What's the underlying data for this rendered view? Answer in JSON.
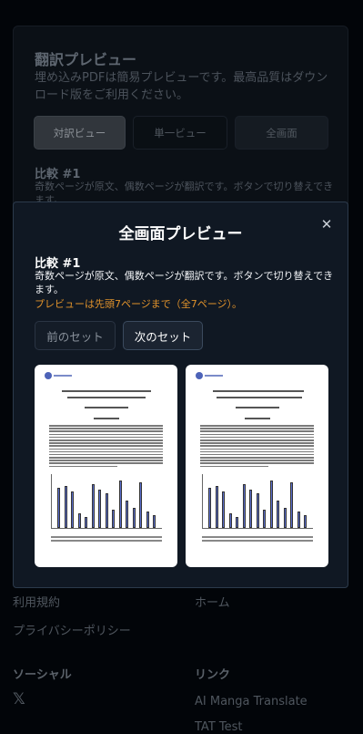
{
  "background": {
    "title": "翻訳プレビュー",
    "description": "埋め込みPDFは簡易プレビューです。最高品質はダウンロード版をご利用ください。",
    "view_buttons": {
      "side_by_side": "対訳ビュー",
      "single": "単一ビュー",
      "fullscreen": "全画面"
    },
    "compare_title": "比較 #1",
    "compare_desc": "奇数ページが原文、偶数ページが翻訳です。ボタンで切り替えできます。",
    "footer": {
      "terms": "利用規約",
      "privacy": "プライバシーポリシー",
      "home": "ホーム",
      "social_heading": "ソーシャル",
      "links_heading": "リンク",
      "x_icon_label": "𝕏",
      "link_manga": "AI Manga Translate",
      "link_tat": "TAT Test"
    }
  },
  "modal": {
    "title": "全画面プレビュー",
    "close_icon": "close-icon",
    "compare_title": "比較 #1",
    "compare_desc": "奇数ページが原文、偶数ページが翻訳です。ボタンで切り替えできます。",
    "note": "プレビューは先頭7ページまで（全7ページ）。",
    "prev_button": "前のセット",
    "next_button": "次のセット",
    "pages": [
      {
        "kind": "original"
      },
      {
        "kind": "translated"
      }
    ]
  },
  "colors": {
    "modal_bg": "#101823",
    "note_orange": "#e0922b",
    "chart_bar": "#5b6fd0"
  }
}
